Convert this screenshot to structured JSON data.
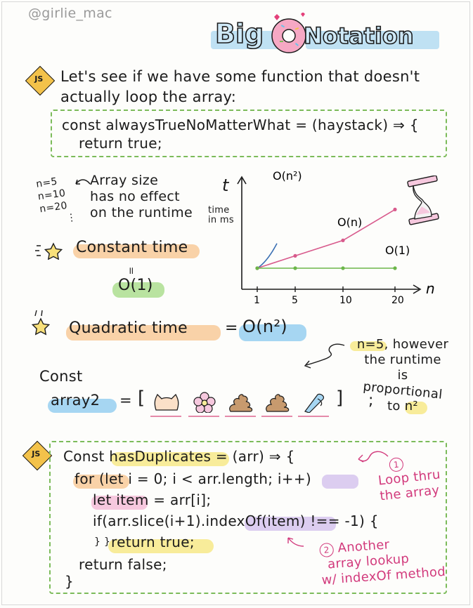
{
  "header": {
    "credit": "@girlie_mac",
    "title_big": "Big",
    "title_o": "O",
    "title_notation": "Notation"
  },
  "intro": {
    "badge": "JS",
    "line1": "Let's see if we have some function that doesn't",
    "line2": "actually loop the array:"
  },
  "code1": {
    "line1": "const alwaysTrueNoMatterWhat = (haystack) ⇒ {",
    "line2": "return true;"
  },
  "constant_section": {
    "n_values": [
      "n=5",
      "n=10",
      "n=20",
      "⋮"
    ],
    "note_line1": "Array size",
    "note_line2": "has no effect",
    "note_line3": "on the runtime",
    "label": "Constant time",
    "equals": "॥",
    "notation": "O(1)"
  },
  "chart_data": {
    "type": "line",
    "y_axis_letter": "t",
    "ylabel_line1": "time",
    "ylabel_line2": "in ms",
    "xlabel": "n",
    "x_ticks": [
      1,
      5,
      10,
      20
    ],
    "series": [
      {
        "name": "O(n²)",
        "color": "#3a6fb3",
        "x": [
          1,
          2,
          3,
          4,
          5
        ],
        "y": [
          1,
          4,
          9,
          16,
          25
        ]
      },
      {
        "name": "O(n)",
        "color": "#d85a8c",
        "x": [
          1,
          5,
          10,
          20
        ],
        "y": [
          1,
          5,
          10,
          20
        ]
      },
      {
        "name": "O(1)",
        "color": "#6cb64a",
        "x": [
          1,
          5,
          10,
          20
        ],
        "y": [
          1,
          1,
          1,
          1
        ]
      }
    ]
  },
  "quadratic_section": {
    "label": "Quadratic time",
    "equals": "=",
    "notation": "O(n²)"
  },
  "array2": {
    "keyword": "Const",
    "name": "array2",
    "equals": "=",
    "open": "[",
    "close": "]",
    "semicolon": ";",
    "items": [
      "cat-icon",
      "flower-icon",
      "poop-icon",
      "poop-icon",
      "pen-icon"
    ],
    "note_line1": "n=5, however",
    "note_line2": "the runtime",
    "note_line3": "is",
    "note_line4": "proportional",
    "note_line5": "to n²"
  },
  "code2": {
    "badge": "JS",
    "line1": "Const hasDuplicates = (arr) ⇒ {",
    "line2": "for (let i = 0; i < arr.length; i++)",
    "line3": "let item = arr[i];",
    "line4": "if(arr.slice(i+1).indexOf(item) !== -1) {",
    "line5": "return true;",
    "line5_brace": "} }",
    "line6": "return false;",
    "line7": "}"
  },
  "annotations": {
    "loop_num": "1",
    "loop_line1": "Loop thru",
    "loop_line2": "the array",
    "lookup_num": "2",
    "lookup_line1": "Another",
    "lookup_line2": "array lookup",
    "lookup_line3": "w/ indexOf method"
  },
  "colors": {
    "pink": "#d23a7c",
    "green_dash": "#7cbb5a",
    "title_fill": "#cfe9f7"
  }
}
